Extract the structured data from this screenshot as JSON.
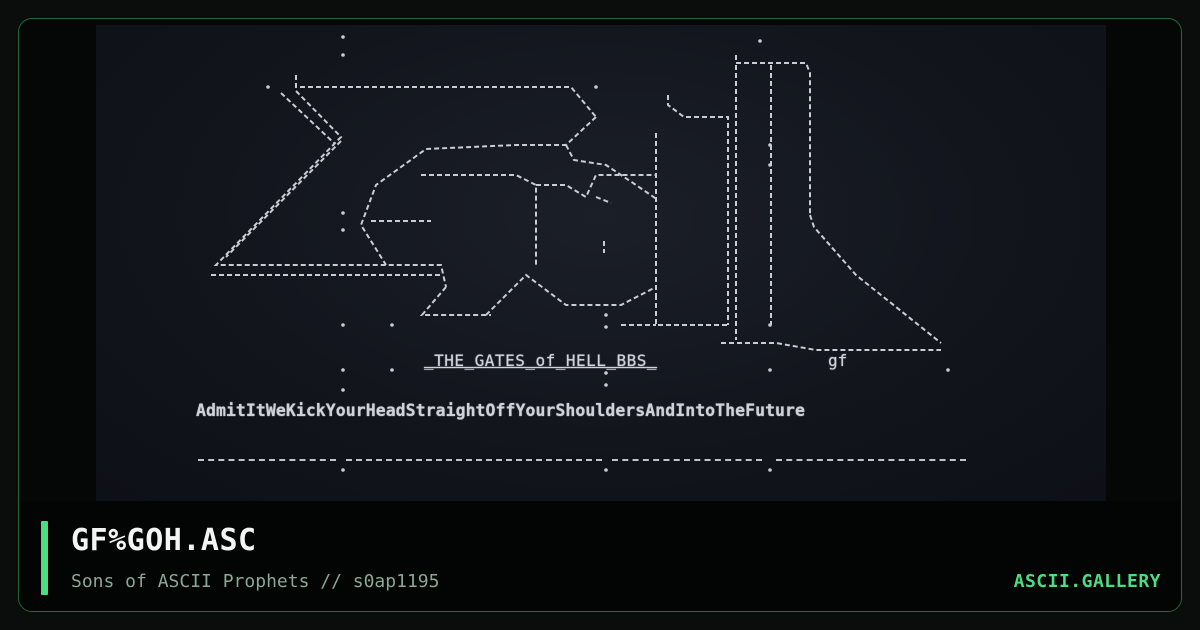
{
  "artwork": {
    "caption": "_THE_GATES_of_HELL_BBS_",
    "signature": "gf",
    "motto": "AdmitItWeKickYourHeadStraightOffYourShouldersAndIntoTheFuture"
  },
  "info": {
    "title": "GF%GOH.ASC",
    "subtitle": "Sons of ASCII Prophets // s0ap1195",
    "brand": "ASCII.GALLERY"
  },
  "colors": {
    "accent": "#4ade80",
    "card_border": "#1f6b3a",
    "art_background": "#12151c",
    "title_text": "#f3f5f4",
    "subtitle_text": "#8aa894"
  }
}
